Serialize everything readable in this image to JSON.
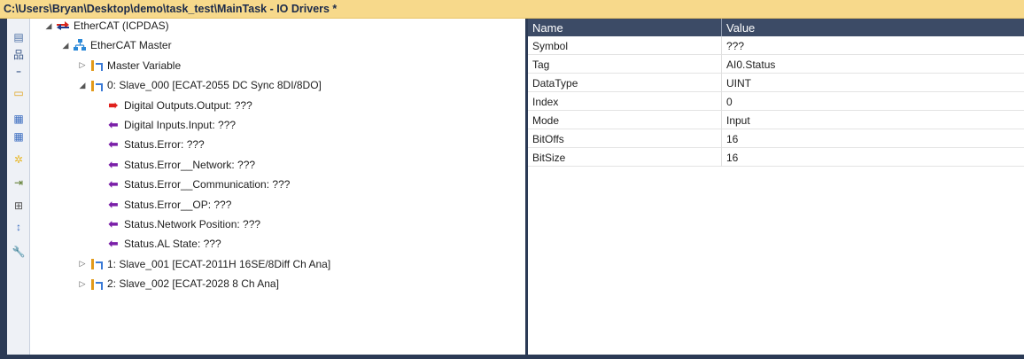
{
  "window": {
    "title": "C:\\Users\\Bryan\\Desktop\\demo\\task_test\\MainTask - IO Drivers *"
  },
  "toolbar": {
    "buttons": [
      {
        "icon": "tree-view-icon",
        "glyph": "▤"
      },
      {
        "icon": "network-icon",
        "glyph": "品"
      },
      {
        "icon": "add-variable-icon",
        "glyph": "⁼"
      },
      {
        "icon": "insert-device-icon",
        "glyph": "▭"
      },
      {
        "icon": "grid-icon",
        "glyph": "▦"
      },
      {
        "icon": "grid-alt-icon",
        "glyph": "▦"
      },
      {
        "icon": "scan-icon",
        "glyph": "✲"
      },
      {
        "icon": "export-icon",
        "glyph": "⇥"
      },
      {
        "icon": "expand-all-icon",
        "glyph": "⊞"
      },
      {
        "icon": "sort-icon",
        "glyph": "↕"
      },
      {
        "icon": "wrench-icon",
        "glyph": "🔧"
      }
    ]
  },
  "tree": {
    "items": [
      {
        "label": "EtherCAT (ICPDAS)",
        "arrow": "◢",
        "icon": "ethercat-icon"
      },
      {
        "label": "EtherCAT Master",
        "arrow": "◢",
        "icon": "master-icon"
      },
      {
        "label": "Master Variable",
        "arrow": "▷",
        "icon": "slave-icon"
      },
      {
        "label": "0: Slave_000 [ECAT-2055 DC Sync 8DI/8DO]",
        "arrow": "◢",
        "icon": "slave-icon"
      },
      {
        "label": "Digital Outputs.Output: ???",
        "arrow": "",
        "icon": "output-variable-icon"
      },
      {
        "label": "Digital Inputs.Input: ???",
        "arrow": "",
        "icon": "input-variable-icon"
      },
      {
        "label": "Status.Error: ???",
        "arrow": "",
        "icon": "input-variable-icon"
      },
      {
        "label": "Status.Error__Network: ???",
        "arrow": "",
        "icon": "input-variable-icon"
      },
      {
        "label": "Status.Error__Communication: ???",
        "arrow": "",
        "icon": "input-variable-icon"
      },
      {
        "label": "Status.Error__OP: ???",
        "arrow": "",
        "icon": "input-variable-icon"
      },
      {
        "label": "Status.Network Position: ???",
        "arrow": "",
        "icon": "input-variable-icon"
      },
      {
        "label": "Status.AL State: ???",
        "arrow": "",
        "icon": "input-variable-icon"
      },
      {
        "label": "1: Slave_001 [ECAT-2011H 16SE/8Diff Ch Ana]",
        "arrow": "▷",
        "icon": "slave-icon"
      },
      {
        "label": "2: Slave_002 [ECAT-2028 8 Ch Ana]",
        "arrow": "▷",
        "icon": "slave-icon"
      }
    ]
  },
  "properties": {
    "columns": {
      "name": "Name",
      "value": "Value"
    },
    "rows": [
      {
        "name": "Symbol",
        "value": "???"
      },
      {
        "name": "Tag",
        "value": "AI0.Status"
      },
      {
        "name": "DataType",
        "value": "UINT"
      },
      {
        "name": "Index",
        "value": "0"
      },
      {
        "name": "Mode",
        "value": "Input"
      },
      {
        "name": "BitOffs",
        "value": "16"
      },
      {
        "name": "BitSize",
        "value": "16"
      }
    ]
  }
}
